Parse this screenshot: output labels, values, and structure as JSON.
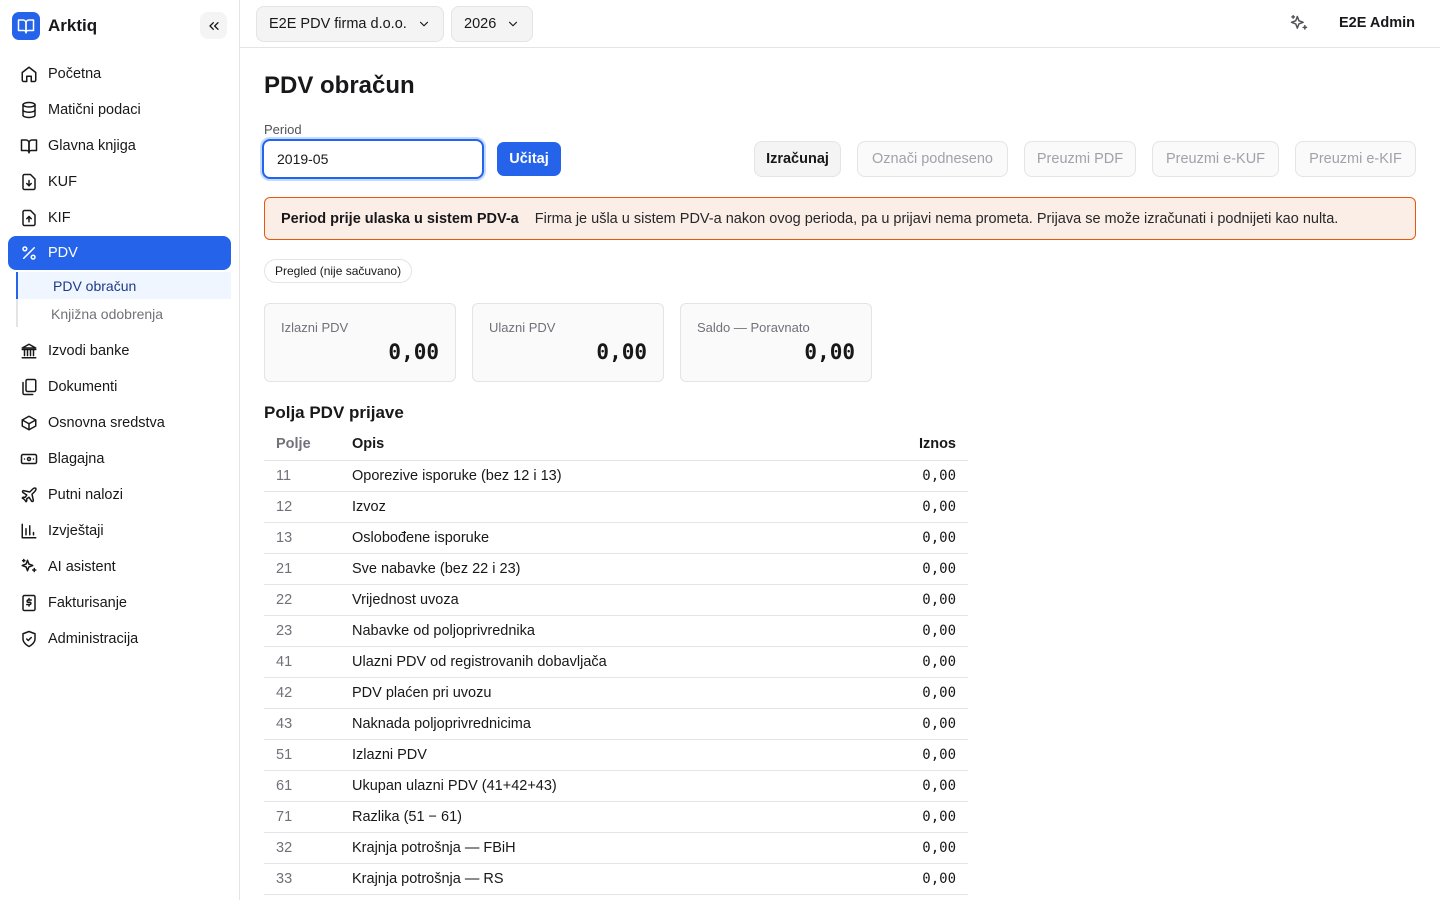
{
  "app": {
    "name": "Arktiq"
  },
  "sidebar": {
    "items": [
      {
        "label": "Početna",
        "icon": "home-icon"
      },
      {
        "label": "Matični podaci",
        "icon": "database-icon"
      },
      {
        "label": "Glavna knjiga",
        "icon": "book-icon"
      },
      {
        "label": "KUF",
        "icon": "file-in-icon"
      },
      {
        "label": "KIF",
        "icon": "file-out-icon"
      },
      {
        "label": "PDV",
        "icon": "percent-icon",
        "active": true
      },
      {
        "label": "Izvodi banke",
        "icon": "bank-icon"
      },
      {
        "label": "Dokumenti",
        "icon": "documents-icon"
      },
      {
        "label": "Osnovna sredstva",
        "icon": "box-icon"
      },
      {
        "label": "Blagajna",
        "icon": "cash-icon"
      },
      {
        "label": "Putni nalozi",
        "icon": "plane-icon"
      },
      {
        "label": "Izvještaji",
        "icon": "chart-icon"
      },
      {
        "label": "AI asistent",
        "icon": "sparkle-icon"
      },
      {
        "label": "Fakturisanje",
        "icon": "invoice-icon"
      },
      {
        "label": "Administracija",
        "icon": "shield-icon"
      }
    ],
    "pdv_sub": [
      {
        "label": "PDV obračun",
        "active": true
      },
      {
        "label": "Knjižna odobrenja"
      }
    ]
  },
  "topbar": {
    "company": "E2E PDV firma d.o.o.",
    "year": "2026",
    "user": "E2E Admin"
  },
  "page": {
    "title": "PDV obračun",
    "period_label": "Period",
    "period_value": "2019-05",
    "load_label": "Učitaj",
    "actions": {
      "calculate": "Izračunaj",
      "mark_submitted": "Označi podneseno",
      "download_pdf": "Preuzmi PDF",
      "download_ekuf": "Preuzmi e-KUF",
      "download_ekif": "Preuzmi e-KIF"
    },
    "alert": {
      "title": "Period prije ulaska u sistem PDV-a",
      "text": "Firma je ušla u sistem PDV-a nakon ovog perioda, pa u prijavi nema prometa. Prijava se može izračunati i podnijeti kao nulta."
    },
    "status": "Pregled (nije sačuvano)",
    "cards": [
      {
        "label": "Izlazni PDV",
        "value": "0,00"
      },
      {
        "label": "Ulazni PDV",
        "value": "0,00"
      },
      {
        "label": "Saldo — Poravnato",
        "value": "0,00"
      }
    ],
    "section_title": "Polja PDV prijave",
    "table": {
      "headers": {
        "field": "Polje",
        "desc": "Opis",
        "amount": "Iznos"
      },
      "rows": [
        {
          "field": "11",
          "desc": "Oporezive isporuke (bez 12 i 13)",
          "amount": "0,00"
        },
        {
          "field": "12",
          "desc": "Izvoz",
          "amount": "0,00"
        },
        {
          "field": "13",
          "desc": "Oslobođene isporuke",
          "amount": "0,00"
        },
        {
          "field": "21",
          "desc": "Sve nabavke (bez 22 i 23)",
          "amount": "0,00"
        },
        {
          "field": "22",
          "desc": "Vrijednost uvoza",
          "amount": "0,00"
        },
        {
          "field": "23",
          "desc": "Nabavke od poljoprivrednika",
          "amount": "0,00"
        },
        {
          "field": "41",
          "desc": "Ulazni PDV od registrovanih dobavljača",
          "amount": "0,00"
        },
        {
          "field": "42",
          "desc": "PDV plaćen pri uvozu",
          "amount": "0,00"
        },
        {
          "field": "43",
          "desc": "Naknada poljoprivrednicima",
          "amount": "0,00"
        },
        {
          "field": "51",
          "desc": "Izlazni PDV",
          "amount": "0,00"
        },
        {
          "field": "61",
          "desc": "Ukupan ulazni PDV (41+42+43)",
          "amount": "0,00"
        },
        {
          "field": "71",
          "desc": "Razlika (51 − 61)",
          "amount": "0,00"
        },
        {
          "field": "32",
          "desc": "Krajnja potrošnja — FBiH",
          "amount": "0,00"
        },
        {
          "field": "33",
          "desc": "Krajnja potrošnja — RS",
          "amount": "0,00"
        }
      ]
    }
  },
  "colors": {
    "accent": "#2563eb",
    "alert_border": "#ea580c",
    "alert_bg": "#fbeee6"
  }
}
